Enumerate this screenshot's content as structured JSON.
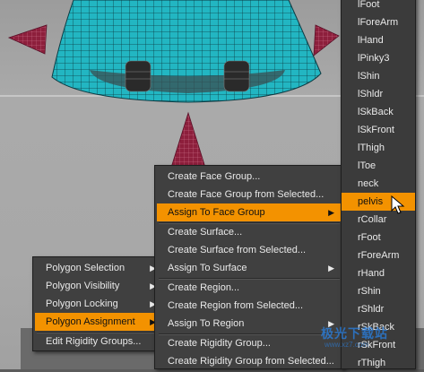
{
  "bone_list": {
    "items": [
      "lFoot",
      "lForeArm",
      "lHand",
      "lPinky3",
      "lShin",
      "lShldr",
      "lSkBack",
      "lSkFront",
      "lThigh",
      "lToe",
      "neck",
      "pelvis",
      "rCollar",
      "rFoot",
      "rForeArm",
      "rHand",
      "rShin",
      "rShldr",
      "rSkBack",
      "rSkFront",
      "rThigh"
    ],
    "selected": "pelvis"
  },
  "face_group_menu": {
    "items": [
      {
        "label": "Create Face Group...",
        "submenu": false
      },
      {
        "label": "Create Face Group from Selected...",
        "submenu": false
      },
      {
        "label": "Assign To Face Group",
        "submenu": true,
        "selected": true
      },
      {
        "label": "Create Surface...",
        "submenu": false
      },
      {
        "label": "Create Surface from Selected...",
        "submenu": false
      },
      {
        "label": "Assign To Surface",
        "submenu": true
      },
      {
        "label": "Create Region...",
        "submenu": false
      },
      {
        "label": "Create Region from Selected...",
        "submenu": false
      },
      {
        "label": "Assign To Region",
        "submenu": true
      },
      {
        "label": "Create Rigidity Group...",
        "submenu": false
      },
      {
        "label": "Create Rigidity Group from Selected...",
        "submenu": false
      }
    ]
  },
  "polygon_menu": {
    "items": [
      {
        "label": "Polygon Selection",
        "submenu": true
      },
      {
        "label": "Polygon Visibility",
        "submenu": true
      },
      {
        "label": "Polygon Locking",
        "submenu": true
      },
      {
        "label": "Polygon Assignment",
        "submenu": true,
        "selected": true
      },
      {
        "label": "Edit Rigidity Groups...",
        "submenu": false
      }
    ]
  },
  "submenu_arrow": "▶",
  "watermark": {
    "text": "极光下载站",
    "sub": "www.xz7.com"
  },
  "colors": {
    "highlight": "#f39200",
    "menu_bg": "#404040",
    "mesh": "#1fb8c4",
    "cone": "#8a2040"
  }
}
